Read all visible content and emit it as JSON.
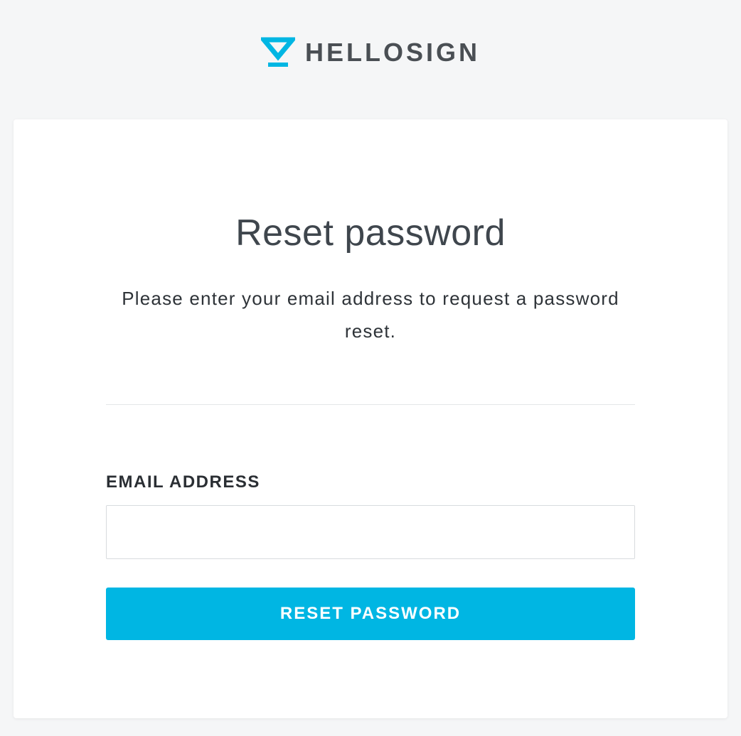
{
  "brand": {
    "name": "HELLOSIGN",
    "accent_color": "#00b6e3"
  },
  "card": {
    "title": "Reset password",
    "subtitle": "Please enter your email address to request a password reset."
  },
  "form": {
    "email_label": "EMAIL ADDRESS",
    "email_value": "",
    "email_placeholder": "",
    "submit_label": "RESET PASSWORD"
  }
}
